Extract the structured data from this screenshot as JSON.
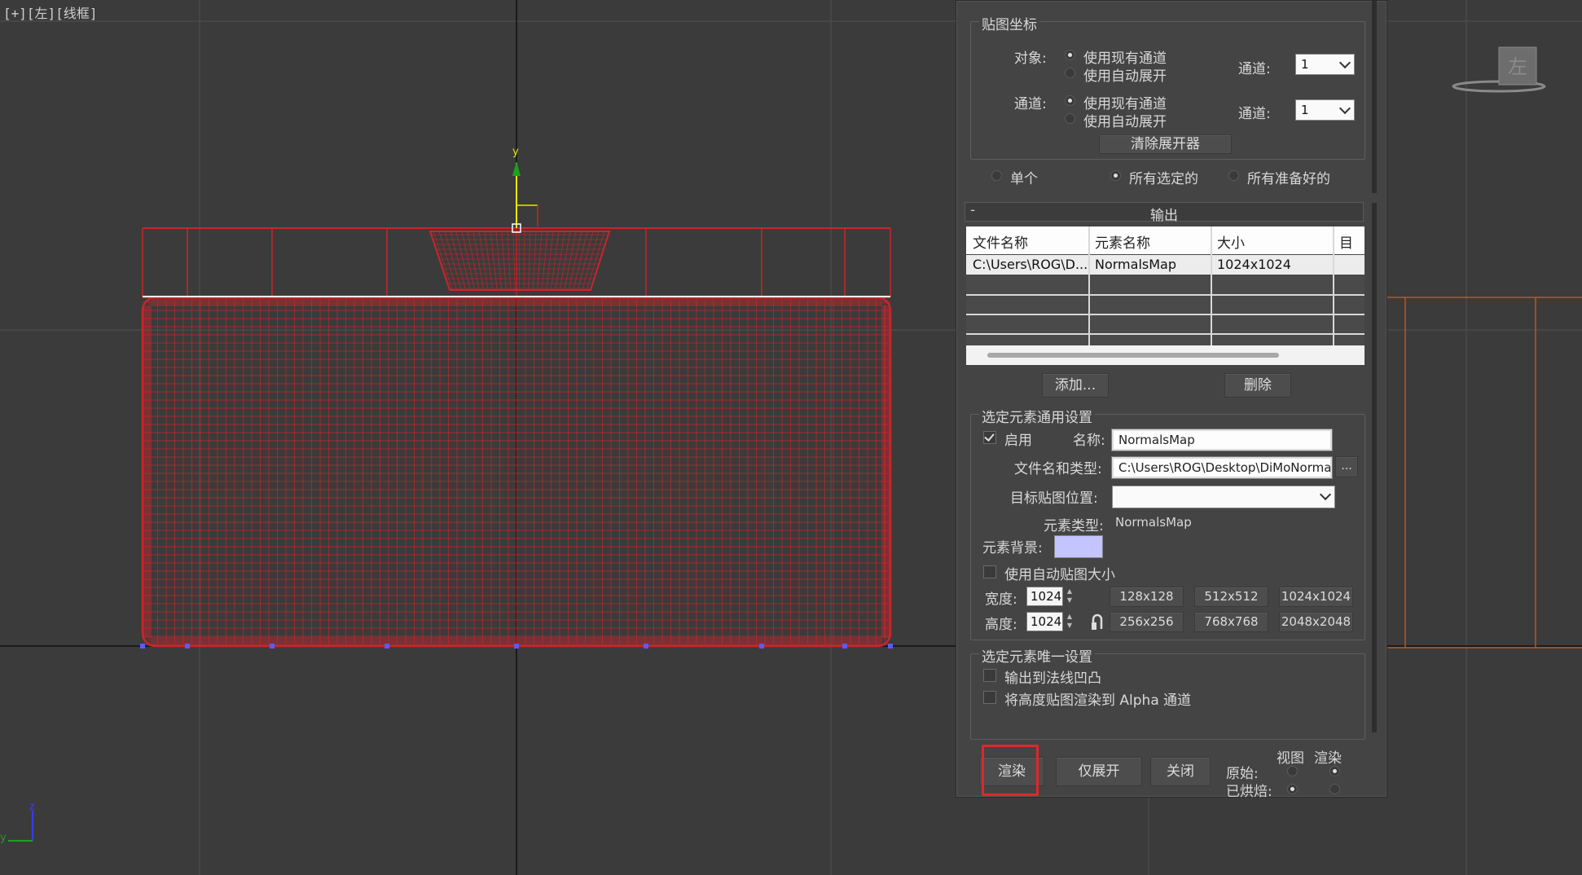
{
  "viewport": {
    "label_plus": "[+]",
    "label_view": "[左]",
    "label_mode": "[线框]",
    "viewcube_label": "左",
    "gizmo_axis_y": "y",
    "tripod_axis_z": "z",
    "tripod_axis_y": "y"
  },
  "mapping": {
    "group_title": "贴图坐标",
    "object_label": "对象:",
    "object_option_existing": "使用现有通道",
    "object_option_auto": "使用自动展开",
    "object_channel_label": "通道:",
    "object_channel_value": "1",
    "subobj_label": "通道:",
    "subobj_option_existing": "使用现有通道",
    "subobj_option_auto": "使用自动展开",
    "subobj_channel_label": "通道:",
    "subobj_channel_value": "1",
    "clear_unwrapper": "清除展开器"
  },
  "selection": {
    "single": "单个",
    "all_selected": "所有选定的",
    "all_prepared": "所有准备好的"
  },
  "output": {
    "title": "输出",
    "collapse": "-",
    "columns": [
      "文件名称",
      "元素名称",
      "大小",
      "目标"
    ],
    "rows": [
      {
        "file": "C:\\Users\\ROG\\D...",
        "element": "NormalsMap",
        "size": "1024x1024",
        "target": ""
      }
    ],
    "add_button": "添加...",
    "delete_button": "删除"
  },
  "common": {
    "group_title": "选定元素通用设置",
    "enable_label": "启用",
    "name_label": "名称:",
    "name_value": "NormalsMap",
    "file_label": "文件名和类型:",
    "file_value": "C:\\Users\\ROG\\Desktop\\DiMoNormalsMap",
    "browse": "...",
    "target_label": "目标贴图位置:",
    "target_value": "",
    "element_type_label": "元素类型:",
    "element_type_value": "NormalsMap",
    "background_label": "元素背景:",
    "background_color": "#c4c4ff",
    "auto_size_label": "使用自动贴图大小",
    "width_label": "宽度:",
    "width_value": "1024",
    "height_label": "高度:",
    "height_value": "1024",
    "sizes": [
      "128x128",
      "512x512",
      "1024x1024",
      "256x256",
      "768x768",
      "2048x2048"
    ]
  },
  "unique": {
    "group_title": "选定元素唯一设置",
    "bump_label": "输出到法线凹凸",
    "alpha_label": "将高度贴图渲染到 Alpha 通道"
  },
  "footer": {
    "render": "渲染",
    "unwrap_only": "仅展开",
    "close": "关闭",
    "col_view": "视图",
    "col_render": "渲染",
    "original": "原始:",
    "baked": "已烘焙:"
  },
  "colors": {
    "wire": "#c8262b",
    "highlight": "#e0262b",
    "background": "#3b3b3b"
  }
}
